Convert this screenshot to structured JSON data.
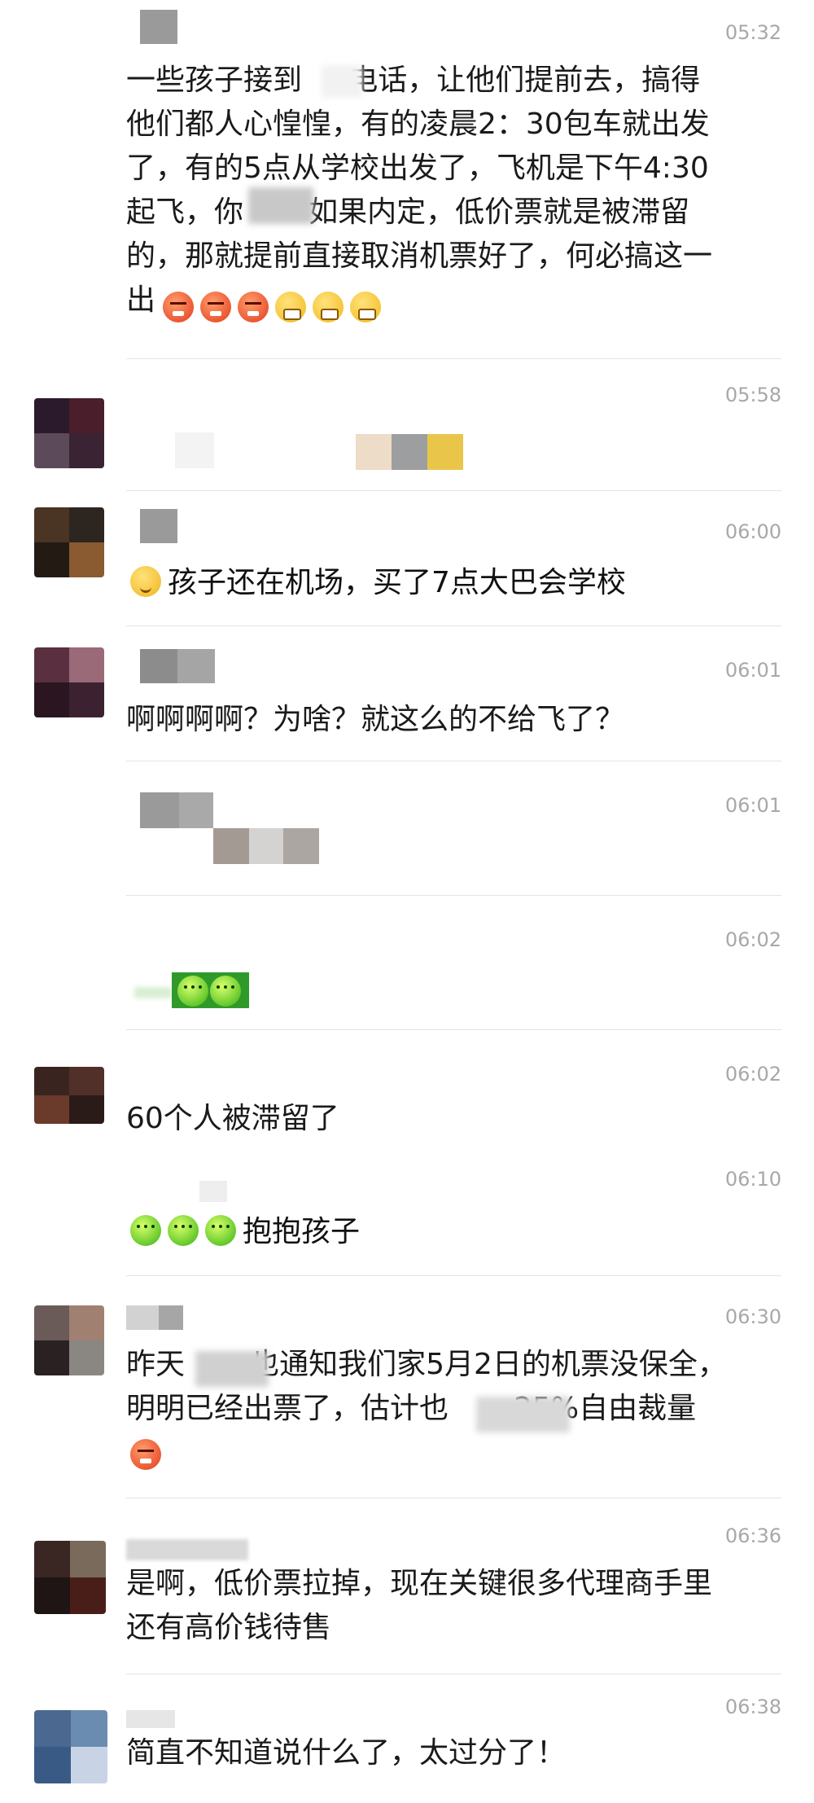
{
  "messages": [
    {
      "time": "05:32",
      "text": "一些孩子接到     电话，让他们提前去，搞得\n他们都人心惶惶，有的凌晨2：30包车就出发\n了，有的5点从学校出发了，飞机是下午4:30\n起飞，你       如果内定，低价票就是被滞留\n的，那就提前直接取消机票好了，何必搞这一\n出"
    },
    {
      "time": "05:58",
      "text": ""
    },
    {
      "time": "06:00",
      "text": "孩子还在机场，买了7点大巴会学校"
    },
    {
      "time": "06:01",
      "text": "啊啊啊啊？为啥？就这么的不给飞了？"
    },
    {
      "time": "06:01",
      "text": ""
    },
    {
      "time": "06:02",
      "text": ""
    },
    {
      "time": "06:02",
      "text": "60个人被滞留了"
    },
    {
      "time": "06:10",
      "text": "抱抱孩子"
    },
    {
      "time": "06:30",
      "text": "昨天       也通知我们家5月2日的机票没保全，\n明明已经出票了，估计也       25%自由裁量"
    },
    {
      "time": "06:36",
      "text": "是啊，低价票拉掉，现在关键很多代理商手里\n还有高价钱待售"
    },
    {
      "time": "06:38",
      "text": "简直不知道说什么了，太过分了！"
    }
  ],
  "emoji": {
    "angry": "angry-face-icon",
    "tired": "tired-face-icon",
    "cry": "crying-face-icon",
    "hug": "hugging-face-icon"
  }
}
